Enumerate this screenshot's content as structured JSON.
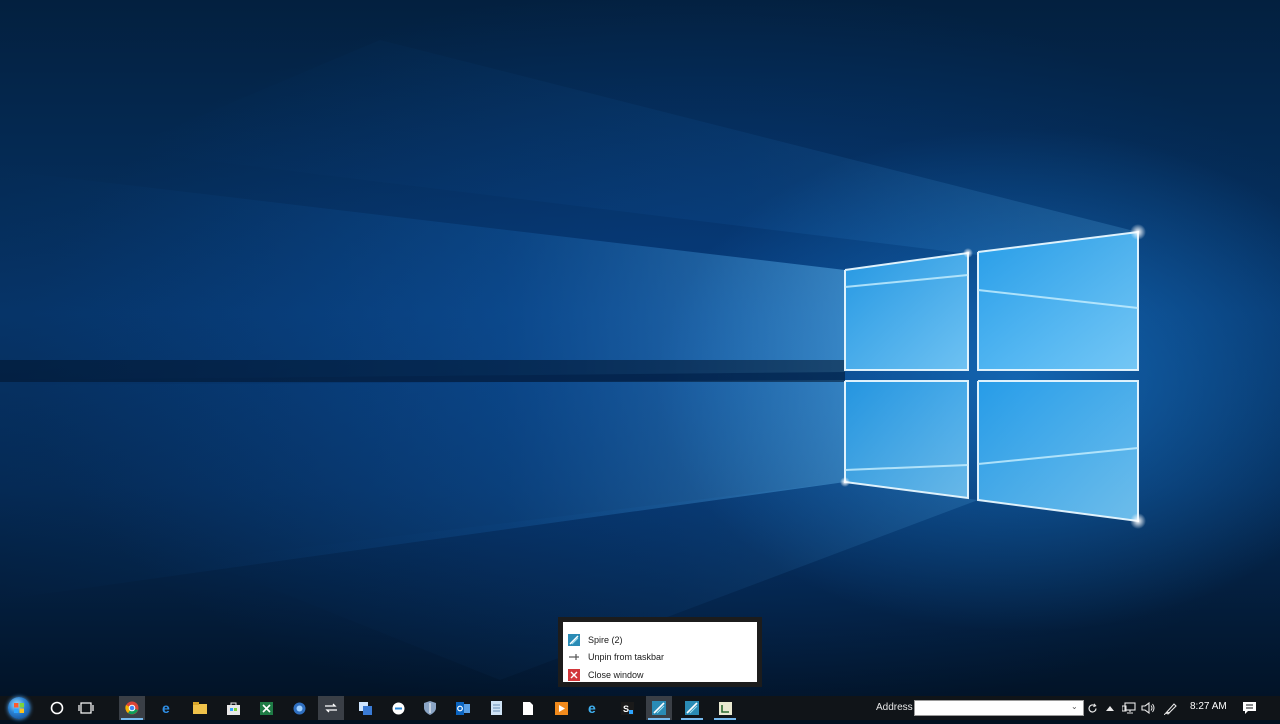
{
  "taskbar": {
    "icons": [
      {
        "name": "start-icon"
      },
      {
        "name": "cortana-icon"
      },
      {
        "name": "task-view-icon"
      },
      {
        "name": "chrome-icon"
      },
      {
        "name": "edge-icon"
      },
      {
        "name": "file-explorer-icon"
      },
      {
        "name": "store-icon"
      },
      {
        "name": "excel-icon"
      },
      {
        "name": "app-icon"
      },
      {
        "name": "sync-app-icon"
      },
      {
        "name": "app-icon"
      },
      {
        "name": "app-icon"
      },
      {
        "name": "shield-icon"
      },
      {
        "name": "outlook-icon"
      },
      {
        "name": "notepad-icon"
      },
      {
        "name": "document-icon"
      },
      {
        "name": "media-player-icon"
      },
      {
        "name": "edge-icon"
      },
      {
        "name": "app-icon"
      },
      {
        "name": "spire-icon"
      },
      {
        "name": "spire-icon"
      },
      {
        "name": "app-icon"
      }
    ],
    "address_label": "Address",
    "address_value": "",
    "clock": "8:27 AM"
  },
  "jumplist": {
    "items": [
      {
        "label": "Spire (2)",
        "icon": "spire-icon"
      },
      {
        "label": "Unpin from taskbar",
        "icon": "unpin-icon"
      },
      {
        "label": "Close window",
        "icon": "close-icon"
      }
    ]
  },
  "colors": {
    "taskbar_bg": "#101418",
    "accent": "#76b9ed",
    "wallpaper_glow": "#4fc3ff",
    "close_icon": "#d2373a"
  }
}
